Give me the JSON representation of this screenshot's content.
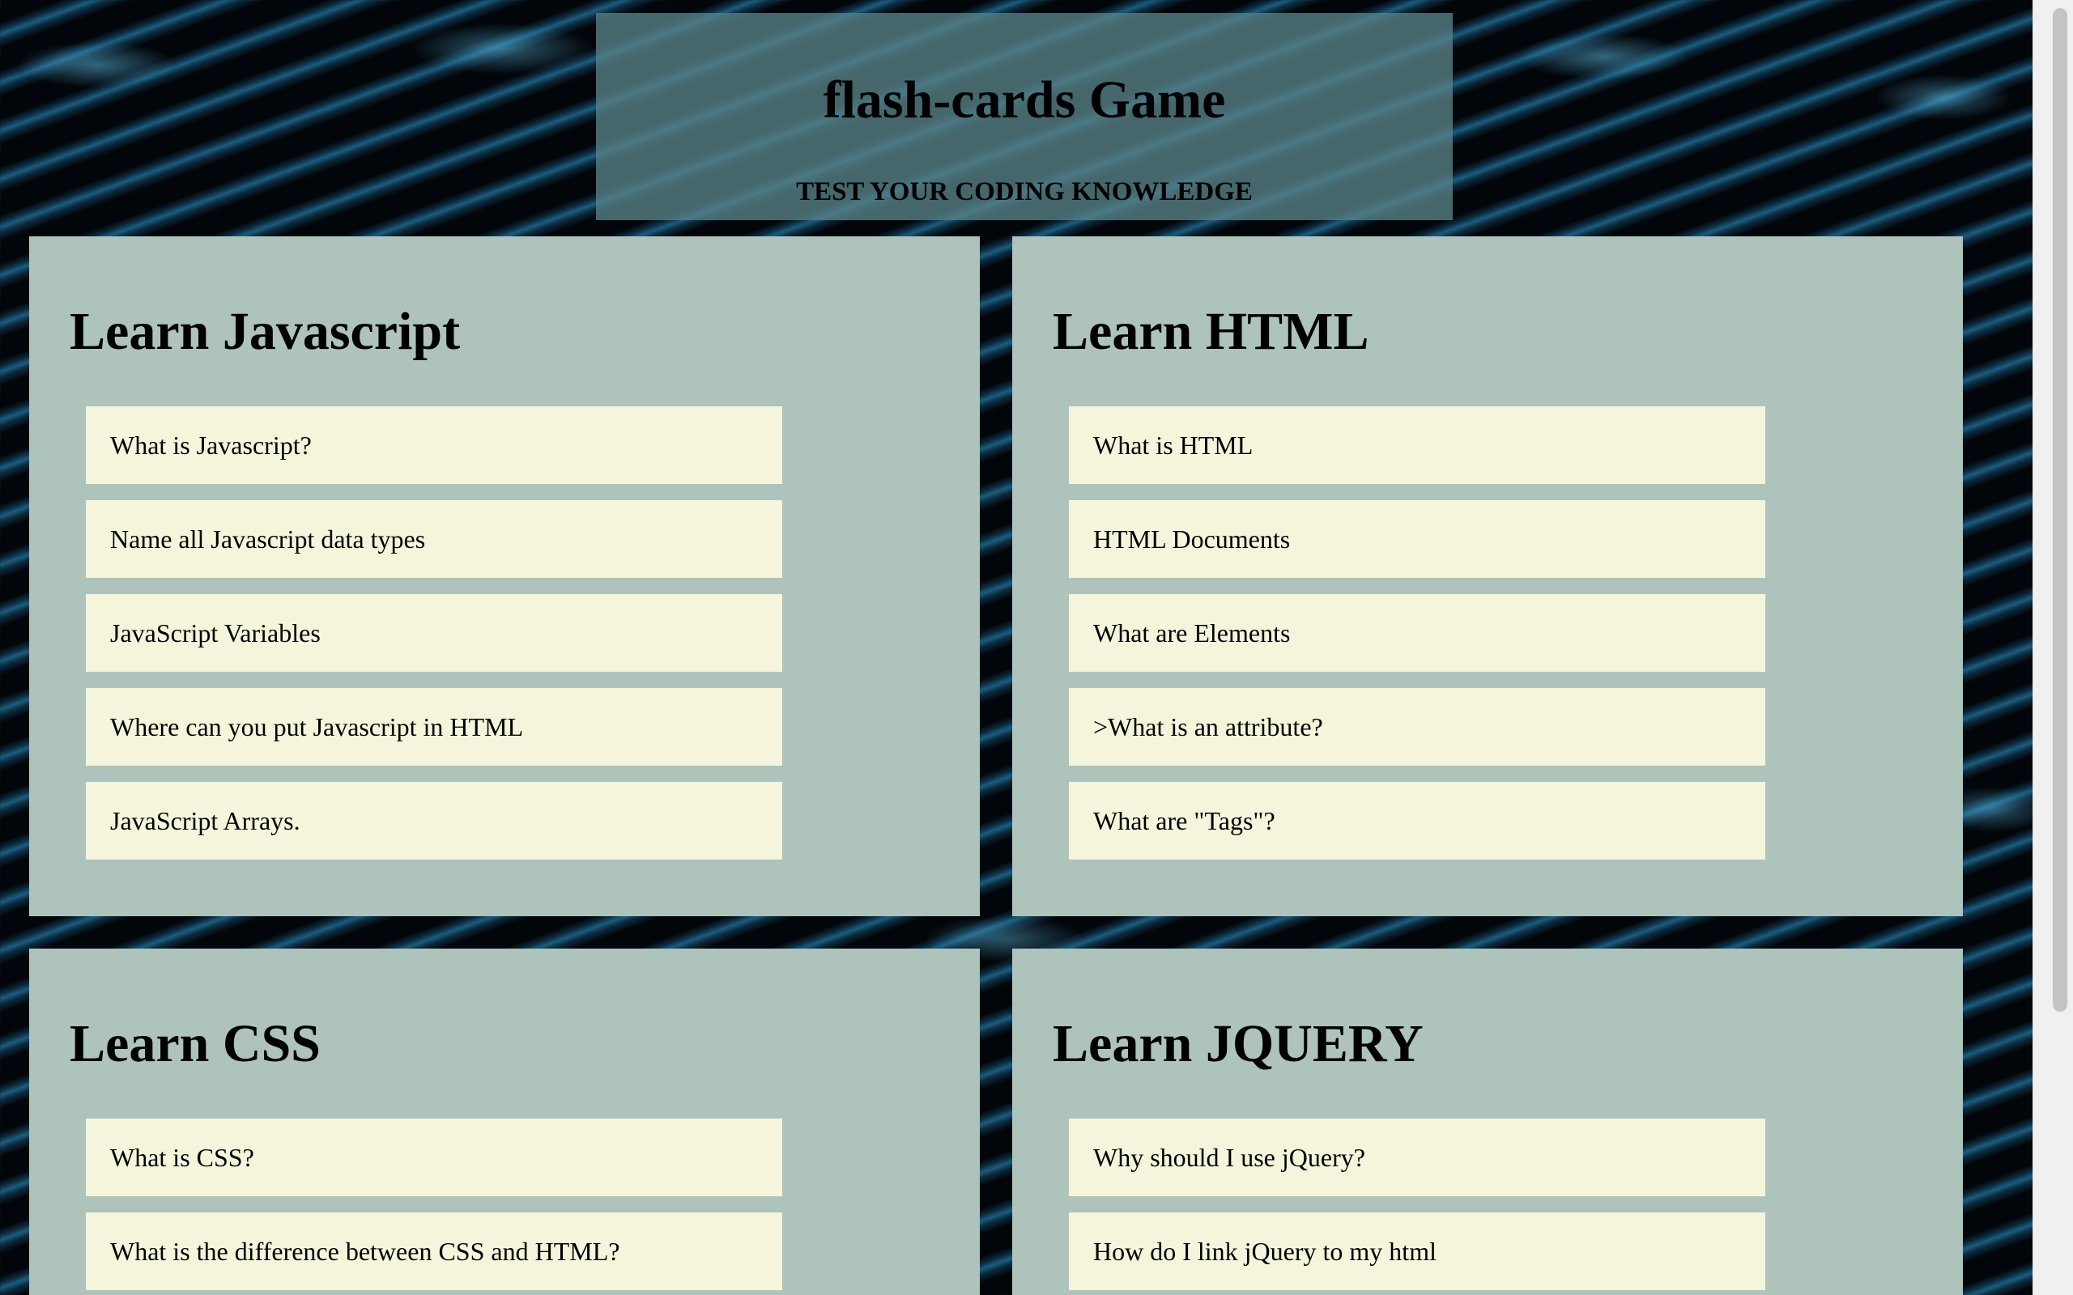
{
  "header": {
    "title": "flash-cards Game",
    "subtitle": "TEST YOUR CODING KNOWLEDGE"
  },
  "sections": [
    {
      "title": "Learn Javascript",
      "cards": [
        "What is Javascript?",
        "Name all Javascript data types",
        "JavaScript Variables",
        "Where can you put Javascript in HTML",
        "JavaScript Arrays."
      ]
    },
    {
      "title": "Learn HTML",
      "cards": [
        "What is HTML",
        "HTML Documents",
        "What are Elements",
        ">What is an attribute?",
        "What are \"Tags\"?"
      ]
    },
    {
      "title": "Learn CSS",
      "cards": [
        "What is CSS?",
        "What is the difference between CSS and HTML?"
      ]
    },
    {
      "title": "Learn JQUERY",
      "cards": [
        "Why should I use jQuery?",
        "How do I link jQuery to my html"
      ]
    }
  ]
}
